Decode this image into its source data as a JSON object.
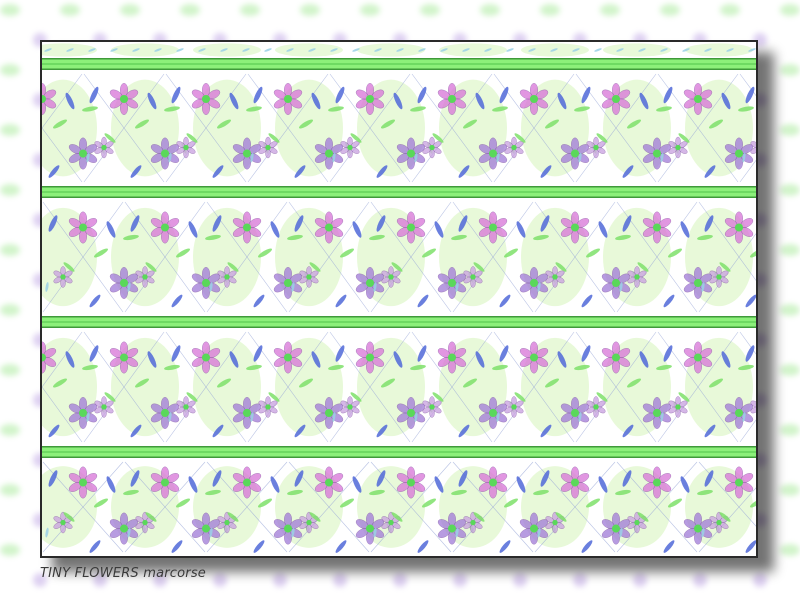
{
  "caption": "TINY FLOWERS marcorse",
  "palette": {
    "green_band": "#8cf07a",
    "green_band_dark": "#4ec24a",
    "band_line": "#3f9a3a",
    "petal_pink": "#d873d8",
    "petal_purple": "#a07ad8",
    "petal_blue": "#5068d8",
    "leaf_green": "#7ee06a",
    "pale_green": "#d8f5c0",
    "center_green": "#5ad85a",
    "light_blue": "#9ad0e6"
  },
  "icons": [
    "flower-pattern",
    "decorative-band"
  ]
}
